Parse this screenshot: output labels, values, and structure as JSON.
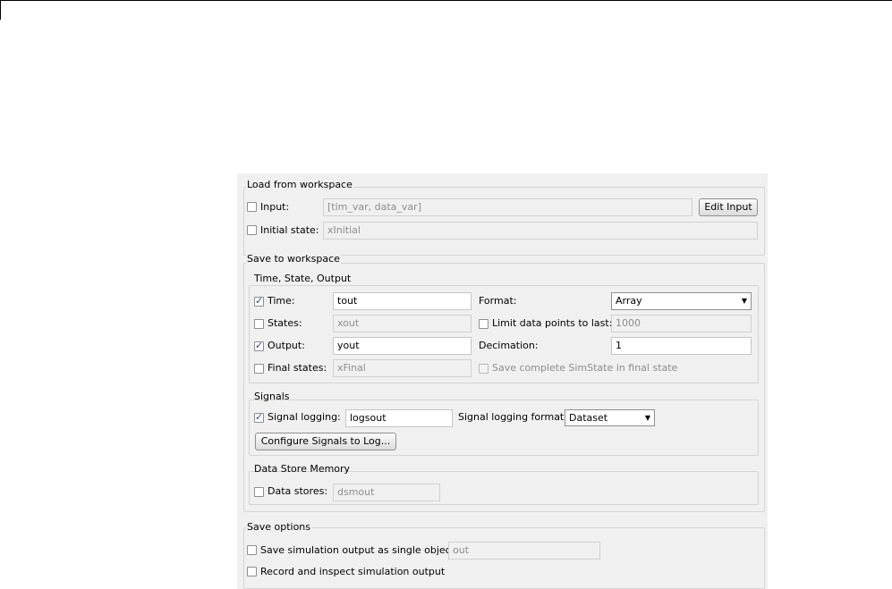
{
  "load_from_workspace": {
    "title": "Load from workspace",
    "input": {
      "label": "Input:",
      "checked": false,
      "value": "[tim_var, data_var]",
      "button": "Edit Input"
    },
    "initial_state": {
      "label": "Initial state:",
      "checked": false,
      "value": "xInitial"
    }
  },
  "save_to_workspace": {
    "title": "Save to workspace",
    "time_state_output": {
      "title": "Time, State, Output",
      "time": {
        "label": "Time:",
        "checked": true,
        "value": "tout"
      },
      "states": {
        "label": "States:",
        "checked": false,
        "value": "xout"
      },
      "output": {
        "label": "Output:",
        "checked": true,
        "value": "yout"
      },
      "final_states": {
        "label": "Final states:",
        "checked": false,
        "value": "xFinal"
      },
      "format": {
        "label": "Format:",
        "value": "Array"
      },
      "limit": {
        "label": "Limit data points to last:",
        "checked": false,
        "value": "1000"
      },
      "decimation": {
        "label": "Decimation:",
        "value": "1"
      },
      "save_simstate": {
        "label": "Save complete SimState in final state",
        "checked": false
      }
    },
    "signals": {
      "title": "Signals",
      "signal_logging": {
        "label": "Signal logging:",
        "checked": true,
        "value": "logsout"
      },
      "format": {
        "label": "Signal logging format:",
        "value": "Dataset"
      },
      "configure_button": "Configure Signals to Log..."
    },
    "data_store_memory": {
      "title": "Data Store Memory",
      "data_stores": {
        "label": "Data stores:",
        "checked": false,
        "value": "dsmout"
      }
    }
  },
  "save_options": {
    "title": "Save options",
    "single_object": {
      "label": "Save simulation output as single object",
      "checked": false,
      "value": "out"
    },
    "record_inspect": {
      "label": "Record and inspect simulation output",
      "checked": false
    }
  },
  "icons": {
    "checkmark": "✓",
    "dropdown": "▼"
  }
}
